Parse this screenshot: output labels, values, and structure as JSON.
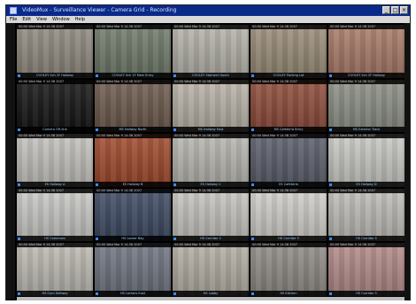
{
  "window": {
    "title": "VideoMux - Surveillance Viewer - Camera Grid - Recording",
    "menu": [
      "File",
      "Edit",
      "View",
      "Window",
      "Help"
    ],
    "buttons": [
      "_",
      "□",
      "×"
    ]
  },
  "cameras": [
    {
      "timestamp": "00:00 Wed Mar 9 14:38 2007",
      "label": "COOLEY Sch 1F Hallway",
      "bg": "#8f8a80"
    },
    {
      "timestamp": "00:00 Wed Mar 9 14:38 2007",
      "label": "COOLEY Sch 1F Main Entry",
      "bg": "#6f7a6a"
    },
    {
      "timestamp": "00:00 Wed Mar 9 14:38 2007",
      "label": "COOLEY Stairwell South",
      "bg": "#b5b2aa"
    },
    {
      "timestamp": "00:00 Wed Mar 9 14:38 2007",
      "label": "COOLEY Parking Lot",
      "bg": "#9a8d78"
    },
    {
      "timestamp": "00:00 Wed Mar 9 14:38 2007",
      "label": "COOLEY Sch 2F Hallway",
      "bg": "#a87a68"
    },
    {
      "timestamp": "00:00 Wed Mar 9 14:38 2007",
      "label": "Camera Off-line",
      "bg": "#141414"
    },
    {
      "timestamp": "00:00 Wed Mar 9 14:38 2007",
      "label": "MS Hallway North",
      "bg": "#6d5a4d"
    },
    {
      "timestamp": "00:00 Wed Mar 9 14:38 2007",
      "label": "MS Hallway East",
      "bg": "#b9b3a8"
    },
    {
      "timestamp": "00:00 Wed Mar 9 14:38 2007",
      "label": "MS Cafeteria Entry",
      "bg": "#8e4b3a"
    },
    {
      "timestamp": "00:00 Wed Mar 9 14:38 2007",
      "label": "MS Exterior Track",
      "bg": "#8c8f86"
    },
    {
      "timestamp": "00:00 Wed Mar 9 14:38 2007",
      "label": "ES Hallway A",
      "bg": "#c4c2bd"
    },
    {
      "timestamp": "00:00 Wed Mar 9 14:38 2007",
      "label": "ES Hallway B",
      "bg": "#a04a2d"
    },
    {
      "timestamp": "00:00 Wed Mar 9 14:38 2007",
      "label": "ES Hallway C",
      "bg": "#b8b6b0"
    },
    {
      "timestamp": "00:00 Wed Mar 9 14:38 2007",
      "label": "ES Cafeteria",
      "bg": "#5a5e6a"
    },
    {
      "timestamp": "00:00 Wed Mar 9 14:38 2007",
      "label": "ES Hallway D",
      "bg": "#c8c8c4"
    },
    {
      "timestamp": "00:00 Wed Mar 9 14:38 2007",
      "label": "HS Commons",
      "bg": "#c9c9c6"
    },
    {
      "timestamp": "00:00 Wed Mar 9 14:38 2007",
      "label": "HS Locker Bay",
      "bg": "#3e4a63"
    },
    {
      "timestamp": "00:00 Wed Mar 9 14:38 2007",
      "label": "HS Corridor 2",
      "bg": "#c7c5c0"
    },
    {
      "timestamp": "00:00 Wed Mar 9 14:38 2007",
      "label": "HS Corridor 3",
      "bg": "#d0cfcb"
    },
    {
      "timestamp": "00:00 Wed Mar 9 14:38 2007",
      "label": "HS Corridor 4",
      "bg": "#bfbdb8"
    },
    {
      "timestamp": "00:00 Wed Mar 9 14:38 2007",
      "label": "HS Gym Hallway",
      "bg": "#bdbab2"
    },
    {
      "timestamp": "00:00 Wed Mar 9 14:38 2007",
      "label": "HS Lockers East",
      "bg": "#6f7480"
    },
    {
      "timestamp": "00:00 Wed Mar 9 14:38 2007",
      "label": "HS Lobby",
      "bg": "#b3aea4"
    },
    {
      "timestamp": "00:00 Wed Mar 9 14:38 2007",
      "label": "HS Kitchen",
      "bg": "#8f8a84"
    },
    {
      "timestamp": "00:00 Wed Mar 9 14:38 2007",
      "label": "HS Corridor 5",
      "bg": "#b28a88"
    }
  ]
}
